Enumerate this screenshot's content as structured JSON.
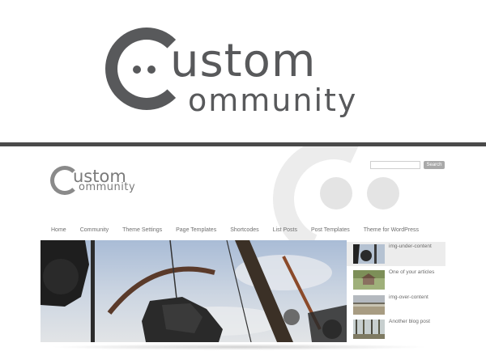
{
  "hero": {
    "logo_word1": "ustom",
    "logo_word2": "ommunity"
  },
  "site": {
    "logo_word1": "ustom",
    "logo_word2": "ommunity",
    "search_button": "Search",
    "search_placeholder": ""
  },
  "nav": {
    "items": [
      {
        "label": "Home"
      },
      {
        "label": "Community"
      },
      {
        "label": "Theme Settings"
      },
      {
        "label": "Page Templates"
      },
      {
        "label": "Shortcodes"
      },
      {
        "label": "List Posts"
      },
      {
        "label": "Post Templates"
      },
      {
        "label": "Theme for WordPress"
      }
    ]
  },
  "slider": {
    "thumbnails": [
      {
        "label": "img-under-content",
        "active": true
      },
      {
        "label": "One of your articles",
        "active": false
      },
      {
        "label": "img-over-content",
        "active": false
      },
      {
        "label": "Another blog post",
        "active": false
      }
    ]
  },
  "colors": {
    "logo": "#58595b",
    "nav_text": "#6f6f6f",
    "divider": "#4a4a4a",
    "active_thumb_bg": "#ececec"
  }
}
